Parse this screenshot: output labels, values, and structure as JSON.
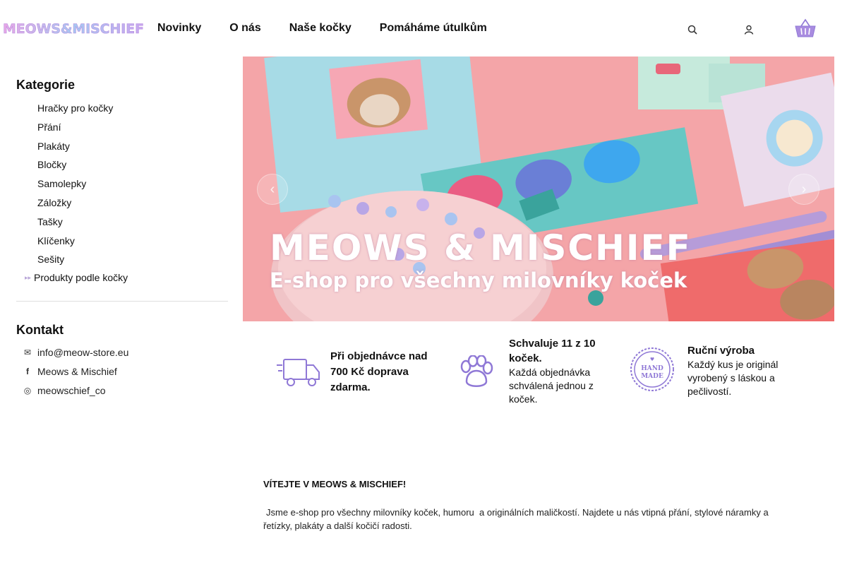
{
  "header": {
    "logo_text": "MEOWS & MISCHIEF",
    "nav": [
      "Novinky",
      "O nás",
      "Naše kočky",
      "Pomáháme útulkům"
    ],
    "icons": [
      "search-icon",
      "user-icon",
      "cart-icon"
    ]
  },
  "sidebar": {
    "categories_title": "Kategorie",
    "categories": [
      "Hračky pro kočky",
      "Přání",
      "Plakáty",
      "Bločky",
      "Samolepky",
      "Záložky",
      "Tašky",
      "Klíčenky",
      "Sešity"
    ],
    "extra_category": "Produkty podle kočky",
    "contact_title": "Kontakt",
    "contact": {
      "email": "info@meow-store.eu",
      "facebook": "Meows & Mischief",
      "instagram": "meowschief_co"
    }
  },
  "hero": {
    "title": "MEOWS & MISCHIEF",
    "subtitle": "E-shop pro všechny milovníky koček"
  },
  "features": [
    {
      "icon": "truck-icon",
      "title": "Při objednávce nad 700 Kč doprava zdarma.",
      "text": ""
    },
    {
      "icon": "paw-icon",
      "title": "Schvaluje 11 z 10 koček.",
      "text": "Každá objednávka schválená jednou z koček."
    },
    {
      "icon": "handmade-icon",
      "title": "Ruční výroba",
      "text": "Každý kus je originál vyrobený s láskou a pečlivostí."
    }
  ],
  "welcome": {
    "title": "VÍTEJTE V MEOWS & MISCHIEF!",
    "text": "Jsme e-shop pro všechny milovníky koček, humoru  a originálních maličkostí. Najdete u nás vtipná přání, stylové náramky a řetízky, plakáty a další kočičí radosti."
  },
  "colors": {
    "accent_purple": "#8f78d6",
    "banner_pink": "#f4a5a8",
    "logo_pink": "#f5a9d6",
    "logo_blue": "#8fc6ee"
  }
}
